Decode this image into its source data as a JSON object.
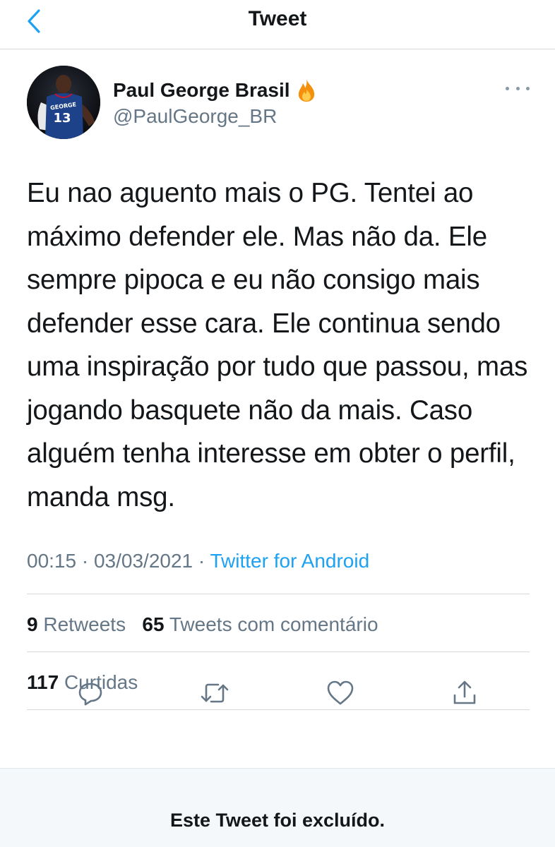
{
  "header": {
    "title": "Tweet"
  },
  "tweet": {
    "author": {
      "name": "Paul George Brasil",
      "handle": "@PaulGeorge_BR",
      "avatar_jersey": "GEORGE",
      "avatar_number": "13"
    },
    "text": "Eu nao aguento mais o PG. Tentei ao máximo defender ele. Mas não da. Ele sempre pipoca e eu não consigo mais defender esse cara. Ele continua sendo uma inspiração por tudo que passou, mas jogando basquete não da mais. Caso alguém tenha interesse em obter o perfil, manda msg.",
    "time": "00:15",
    "separator": "·",
    "date": "03/03/2021",
    "source": "Twitter for Android",
    "stats": {
      "retweets_count": "9",
      "retweets_label": "Retweets",
      "quotes_count": "65",
      "quotes_label": "Tweets com comentário",
      "likes_count": "117",
      "likes_label": "Curtidas"
    }
  },
  "footer": {
    "deleted_notice": "Este Tweet foi excluído."
  },
  "colors": {
    "accent": "#1da1f2",
    "secondary_text": "#657786",
    "divider": "#d6d9dc"
  }
}
